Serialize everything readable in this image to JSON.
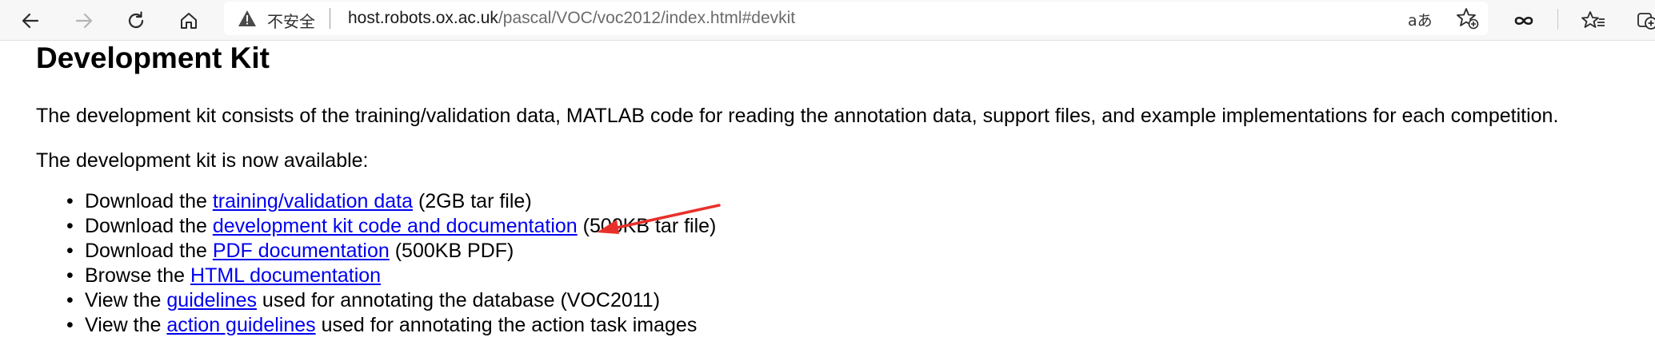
{
  "browser": {
    "security_label": "不安全",
    "url_host": "host.robots.ox.ac.uk",
    "url_path": "/pascal/VOC/voc2012/index.html#devkit",
    "read_aloud_glyph": "aあ",
    "icons": [
      "back-icon",
      "forward-icon",
      "refresh-icon",
      "home-icon",
      "warning-icon",
      "read-aloud-icon",
      "add-favorite-icon",
      "infinity-icon",
      "favorites-icon",
      "collections-icon"
    ]
  },
  "page": {
    "title": "Development Kit",
    "intro": "The development kit consists of the training/validation data, MATLAB code for reading the annotation data, support files, and example implementations for each competition.",
    "availability": "The development kit is now available:",
    "bullet_glyph": "•",
    "items": [
      {
        "prefix": "Download the ",
        "link": "training/validation data",
        "suffix": " (2GB tar file)"
      },
      {
        "prefix": "Download the ",
        "link": "development kit code and documentation",
        "suffix": " (500KB tar file)"
      },
      {
        "prefix": "Download the ",
        "link": "PDF documentation",
        "suffix": " (500KB PDF)"
      },
      {
        "prefix": "Browse the ",
        "link": "HTML documentation",
        "suffix": ""
      },
      {
        "prefix": "View the ",
        "link": "guidelines",
        "suffix": " used for annotating the database (VOC2011)"
      },
      {
        "prefix": "View the ",
        "link": "action guidelines",
        "suffix": " used for annotating the action task images"
      }
    ]
  },
  "colors": {
    "link": "#0000ee",
    "annotation_arrow": "#e8302a",
    "toolbar_bg": "#f7f7f7"
  }
}
